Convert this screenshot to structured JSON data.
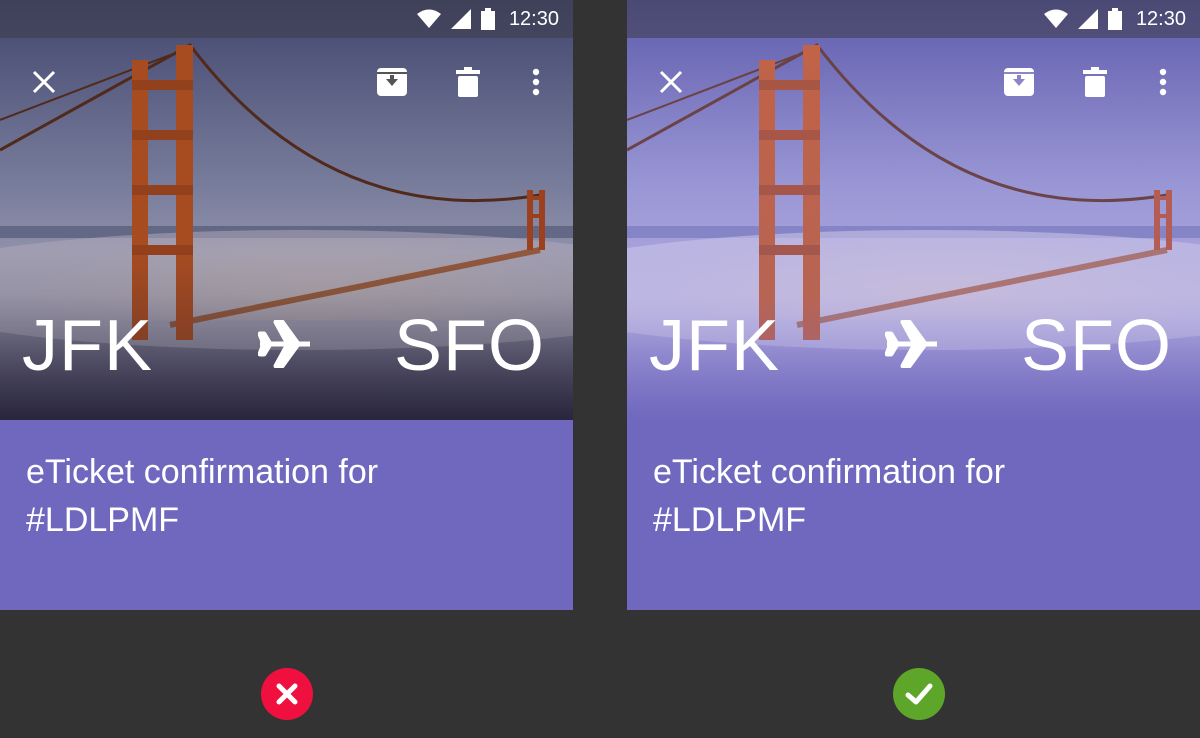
{
  "colors": {
    "page_background": "#333333",
    "card_purple": "#7068be",
    "status_bar": "#3c3c48",
    "incorrect_red": "#f0103f",
    "correct_green": "#5ea62a"
  },
  "panels": [
    {
      "id": "incorrect",
      "status_bar": {
        "time": "12:30",
        "icons": [
          "wifi-icon",
          "cell-signal-icon",
          "battery-icon"
        ]
      },
      "toolbar": {
        "icons": [
          "close-icon",
          "archive-icon",
          "delete-icon",
          "more-vert-icon"
        ]
      },
      "route": {
        "from": "JFK",
        "to": "SFO",
        "icon": "airplane-icon"
      },
      "subject": "eTicket confirmation for #LDLPMF",
      "image_tint": "dark"
    },
    {
      "id": "correct",
      "status_bar": {
        "time": "12:30",
        "icons": [
          "wifi-icon",
          "cell-signal-icon",
          "battery-icon"
        ]
      },
      "toolbar": {
        "icons": [
          "close-icon",
          "archive-icon",
          "delete-icon",
          "more-vert-icon"
        ]
      },
      "route": {
        "from": "JFK",
        "to": "SFO",
        "icon": "airplane-icon"
      },
      "subject": "eTicket confirmation for #LDLPMF",
      "image_tint": "purple"
    }
  ],
  "verdicts": {
    "left": "cross-icon",
    "right": "checkmark-icon"
  }
}
